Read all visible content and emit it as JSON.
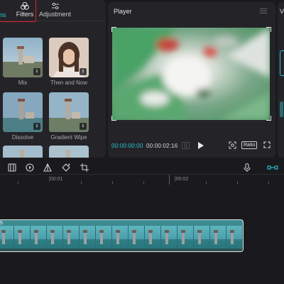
{
  "tabs": {
    "transitions": "ons",
    "filters": "Filters",
    "adjustment": "Adjustment"
  },
  "effects": [
    {
      "name": "Mix"
    },
    {
      "name": "Then and Now"
    },
    {
      "name": "Dissolve"
    },
    {
      "name": "Gradient Wipe"
    },
    {
      "name": ""
    },
    {
      "name": ""
    }
  ],
  "player": {
    "title": "Player",
    "current_time": "00:00:00:00",
    "total_time": "00:00:02:16",
    "ratio_label": "Ratio"
  },
  "right_panel": {
    "title_initial": "V"
  },
  "timeline": {
    "ruler_marks": [
      "|00:01",
      "|00:02"
    ],
    "clip_label": "5"
  },
  "colors": {
    "accent": "#25c4d4",
    "highlight_box": "#e0202a",
    "background": "#1a1a1e",
    "panel": "#242428"
  },
  "icons": [
    "transitions-icon",
    "filters-icon",
    "adjustment-icon",
    "download-icon",
    "menu-icon",
    "frame-step-icon",
    "play-icon",
    "fit-screen-icon",
    "fullscreen-icon",
    "split-icon",
    "freeze-icon",
    "mirror-icon",
    "rotate-icon",
    "crop-icon",
    "microphone-icon",
    "link-icon"
  ]
}
